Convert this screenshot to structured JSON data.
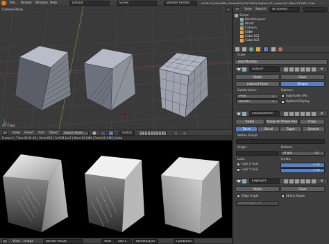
{
  "menubar": {
    "items": [
      "File",
      "Render",
      "Window",
      "Help"
    ],
    "screen_layout": "Default",
    "scene": "Scene",
    "engine": "Blender Render",
    "stats": "v2.69.10 | Verts:650 | Faces:634 | Tris:1268 | Objects:1/3 | Lamps:0/1 | Mem:15.16M | Cube"
  },
  "viewport3d": {
    "view_label": "Camera Persp",
    "object_label": "(1) Cube",
    "header": {
      "items": [
        "View",
        "Select",
        "Add",
        "Object"
      ],
      "mode": "Object Mode",
      "orientation": "Global"
    }
  },
  "image_editor": {
    "info": "Frame:1 | Time:00:01.40 | Verts:650 | Fa:634 La:2 | Mem:16.04M | Peak:40.14M | Cube",
    "header": {
      "items": [
        "View",
        "Image"
      ],
      "image_name": "Render Result",
      "view_label": "View",
      "slot": "Slot 1",
      "layer": "RenderLayer",
      "pass": "Combined"
    }
  },
  "outliner": {
    "header_items": [
      "View",
      "Search"
    ],
    "filter": "All Scenes",
    "items": [
      "Scene",
      "RenderLayers",
      "World",
      "Camera",
      "Cube",
      "Cube.001",
      "Cube.002"
    ]
  },
  "properties": {
    "object_name": "Cube",
    "add_modifier": "Add Modifier",
    "subsurf": {
      "name": "Subsurf",
      "apply": "Apply",
      "copy": "Copy",
      "type_a": "Catmull-Clark",
      "type_b": "Simple",
      "subdivisions_label": "Subdivisions:",
      "view_label": "View:",
      "view_value": "1",
      "render_label": "Render:",
      "render_value": "2",
      "options_label": "Options:",
      "subdivide_uvs": "Subdivide UVs",
      "optimal_display": "Optimal Display"
    },
    "simpledeform": {
      "name": "SimpleDeform",
      "apply": "Apply",
      "apply_shape": "Apply as Shape Key",
      "copy": "Copy",
      "modes": [
        "Twist",
        "Bend",
        "Taper",
        "Stretch"
      ],
      "vertex_group_label": "Vertex Group:",
      "origin_label": "Origin:",
      "deform_label": "Deform:",
      "angle_label": "Angle:",
      "angle_value": "45°",
      "lock_label": "Lock:",
      "lock_x": "Lock X Axis",
      "lock_y": "Lock Y Axis",
      "limits_label": "Limits:",
      "limit_min": "0.00",
      "limit_max": "1.00"
    },
    "edgesplit": {
      "name": "EdgeSplit",
      "apply": "Apply",
      "copy": "Copy",
      "edge_angle": "Edge Angle",
      "sharp_edges": "Sharp Edges",
      "split_angle": "Split Angle: 30°"
    }
  }
}
